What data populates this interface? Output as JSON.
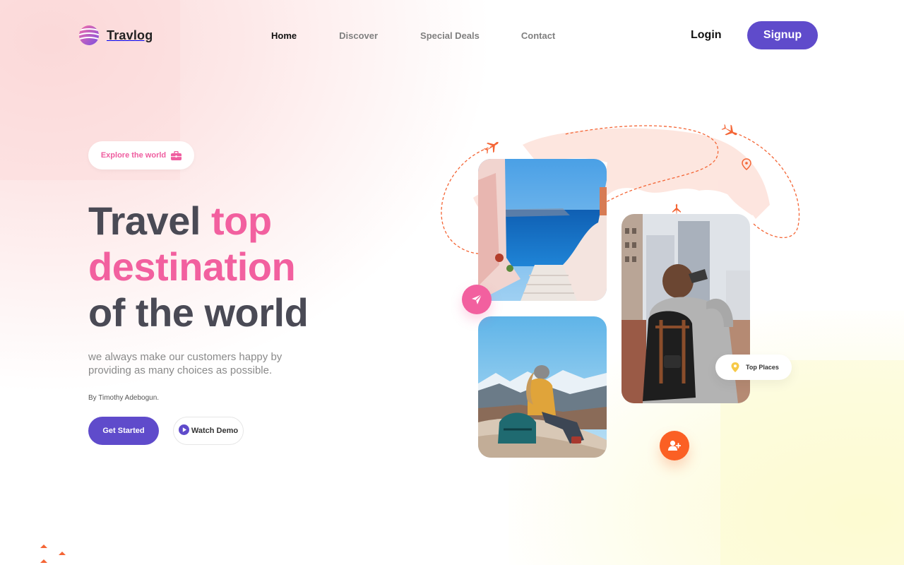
{
  "brand": {
    "name": "Travlog"
  },
  "nav": {
    "items": [
      {
        "label": "Home",
        "active": true
      },
      {
        "label": "Discover",
        "active": false
      },
      {
        "label": "Special Deals",
        "active": false
      },
      {
        "label": "Contact",
        "active": false
      }
    ],
    "login_label": "Login",
    "signup_label": "Signup"
  },
  "hero": {
    "badge": "Explore the world",
    "headline": {
      "part1": "Travel ",
      "part2_highlight": "top",
      "part3_highlight": "destination",
      "part4": "of the world"
    },
    "subtitle": "we always make our customers happy by providing as many choices as possible.",
    "author": "By Timothy Adebogun.",
    "primary_button": "Get Started",
    "secondary_button": "Watch Demo"
  },
  "cards": {
    "top_places_label": "Top Places"
  },
  "icons": {
    "logo": "striped-globe-icon",
    "badge": "briefcase-icon",
    "demo": "play-icon",
    "send": "paper-plane-icon",
    "user": "add-user-icon",
    "pin": "location-pin-icon",
    "plane": "airplane-icon"
  },
  "colors": {
    "primary": "#5f4bcb",
    "pink": "#f2609f",
    "orange": "#fb6024",
    "heading": "#4a4a55",
    "text_muted": "#8a8a8a",
    "pin_yellow": "#f7c948"
  }
}
